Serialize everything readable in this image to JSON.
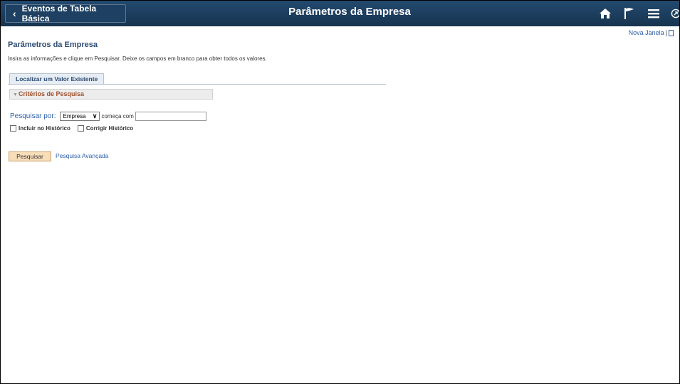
{
  "banner": {
    "back_label": "Eventos de Tabela Básica",
    "title": "Parâmetros da Empresa",
    "icons": [
      "home-icon",
      "flag-icon",
      "menu-icon",
      "navbar-icon"
    ]
  },
  "links": {
    "new_window": "Nova Janela",
    "separator": "|"
  },
  "page": {
    "title": "Parâmetros da Empresa",
    "instructions": "Insira as informações e clique em Pesquisar. Deixe os campos em branco para obter todos os valores."
  },
  "tabs": [
    {
      "label": "Localizar um Valor Existente"
    }
  ],
  "criteria": {
    "section_label": "Critérios de Pesquisa",
    "search_by_label": "Pesquisar por:",
    "search_by_value": "Empresa",
    "condition": "começa com",
    "search_value": "",
    "include_history_label": "Incluir no Histórico",
    "correct_history_label": "Corrigir Histórico"
  },
  "actions": {
    "search_button": "Pesquisar",
    "advanced_search_link": "Pesquisa Avançada"
  },
  "colors": {
    "banner": "#1b3c5e",
    "link": "#2d5ea8",
    "section_text": "#a0522d",
    "search_button_bg": "#f7ddb8"
  }
}
